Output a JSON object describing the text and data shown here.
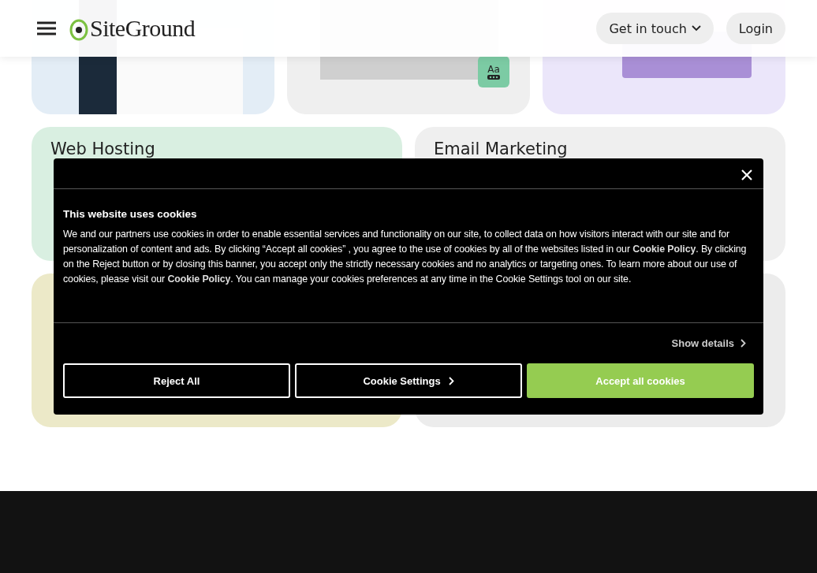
{
  "header": {
    "logo": "SiteGround",
    "buttons": [
      {
        "label": "Get in touch",
        "kind": "dropdown"
      },
      {
        "label": "Login",
        "kind": "plain"
      }
    ]
  },
  "top_cards": [
    {
      "kind": "dashboard"
    },
    {
      "kind": "photo",
      "badge": "Aa"
    },
    {
      "kind": "video"
    }
  ],
  "product_cards": [
    {
      "title": "Web Hosting"
    },
    {
      "title": "Email Marketing"
    }
  ],
  "cookie_banner": {
    "title": "This website uses cookies",
    "body": "We and our partners use cookies in order to enable essential services and functionality on our site, to collect data on how visitors interact with our site and for personalization of content and ads. By clicking  “Accept all cookies” , you agree to the use of cookies by all of the websites listed in our ",
    "link_1": "Cookie Policy",
    "body_2": ". By clicking on the Reject button or by closing this banner, you accept only the strictly necessary cookies and no analytics or targeting ones. To learn more about our use of cookies, please visit our ",
    "link_2": "Cookie Policy",
    "body_3": ". You can manage your cookies preferences at any time in the Cookie Settings tool on our site.",
    "show_details": "Show details",
    "buttons": [
      {
        "label": "Reject All",
        "kind": "outline"
      },
      {
        "label": "Cookie Settings",
        "kind": "outline-arrow"
      },
      {
        "label": "Accept all cookies",
        "kind": "primary"
      }
    ]
  }
}
